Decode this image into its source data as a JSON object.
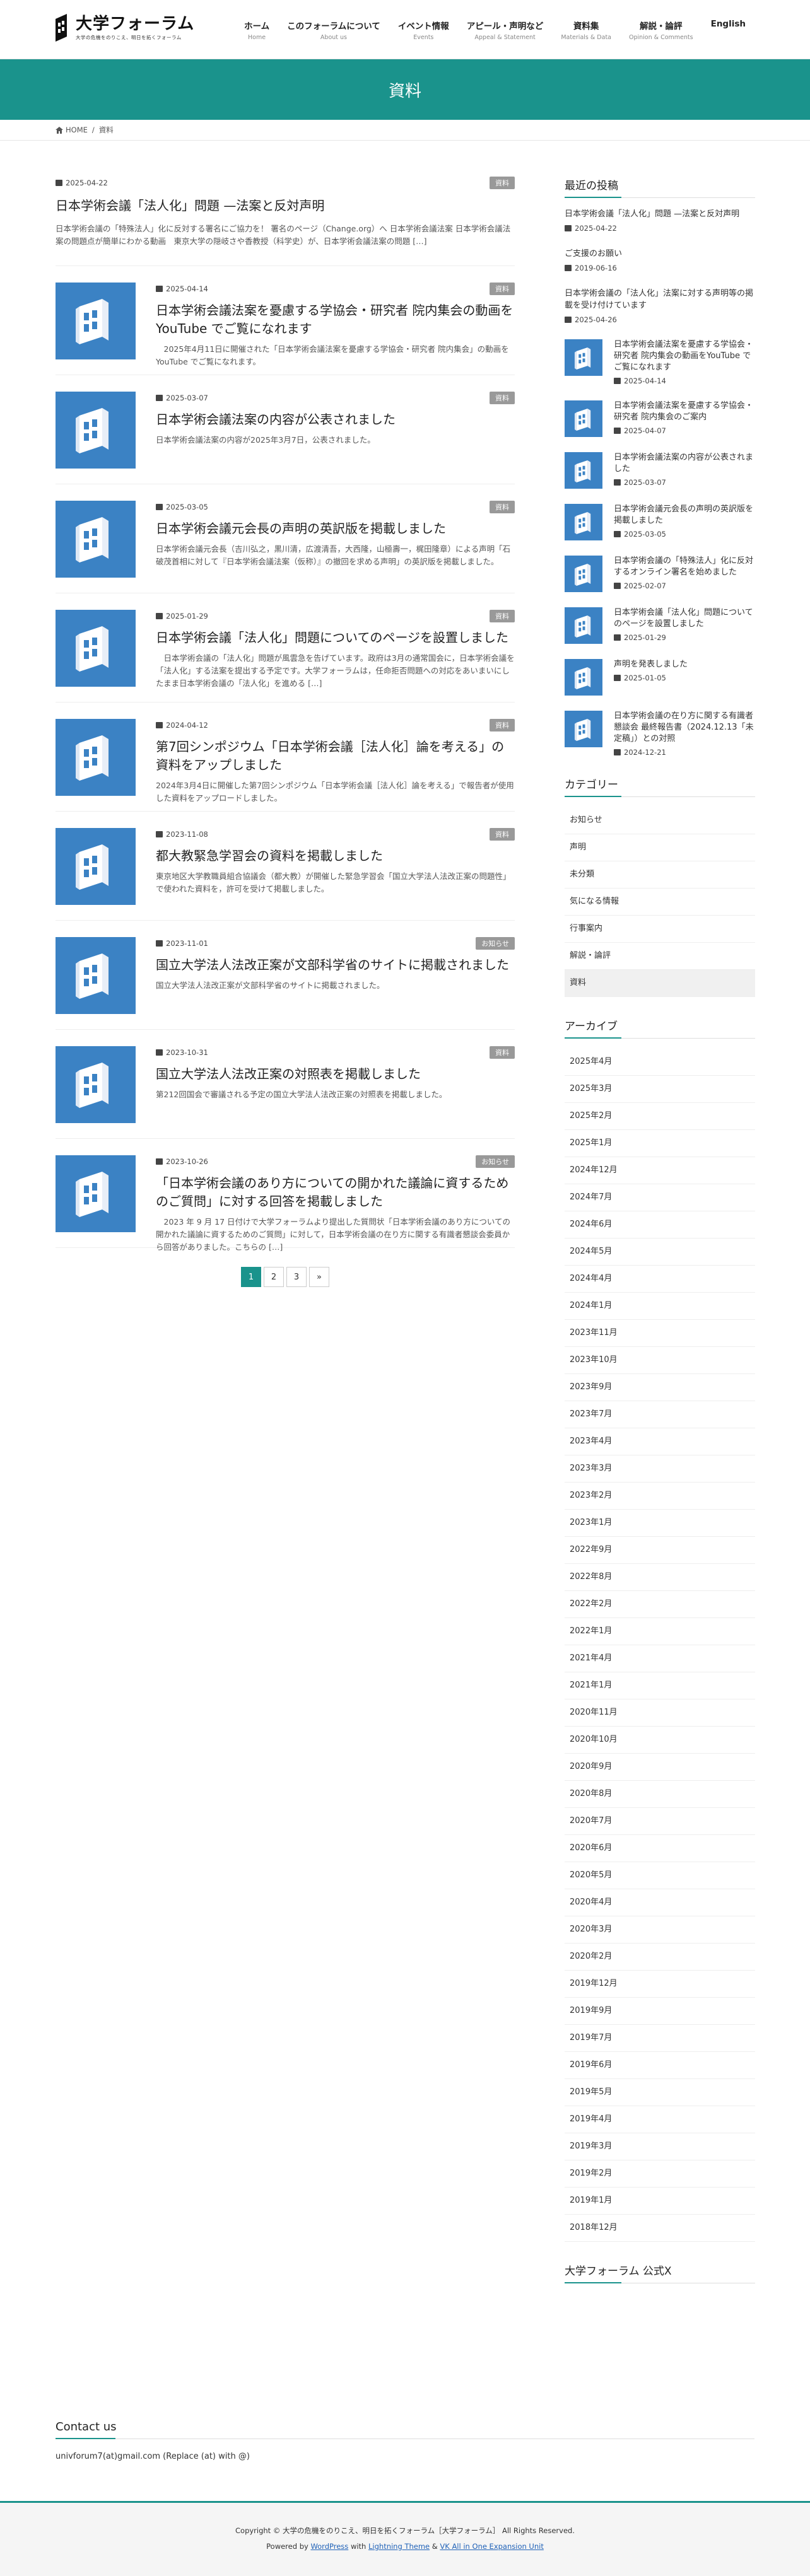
{
  "site": {
    "logo_main": "大学フォーラム",
    "logo_sub": "大学の危機をのりこえ、明日を拓くフォーラム"
  },
  "nav": [
    {
      "ja": "ホーム",
      "en": "Home"
    },
    {
      "ja": "このフォーラムについて",
      "en": "About us"
    },
    {
      "ja": "イベント情報",
      "en": "Events"
    },
    {
      "ja": "アピール・声明など",
      "en": "Appeal & Statement"
    },
    {
      "ja": "資料集",
      "en": "Materials & Data"
    },
    {
      "ja": "解説・論評",
      "en": "Opinion & Comments"
    },
    {
      "ja": "English",
      "en": ""
    }
  ],
  "page_title": "資料",
  "breadcrumb": {
    "home": "HOME",
    "sep": "/",
    "current": "資料"
  },
  "first_post": {
    "date": "2025-04-22",
    "badge": "資料",
    "title": "日本学術会議「法人化」問題 —法案と反対声明",
    "excerpt": "日本学術会議の「特殊法人」化に反対する署名にご協力を！ 署名のページ（Change.org）へ 日本学術会議法案 日本学術会議法案の問題点が簡単にわかる動画　東京大学の隠岐さや香教授（科学史）が、日本学術会議法案の問題 […]"
  },
  "posts": [
    {
      "date": "2025-04-14",
      "badge": "資料",
      "title": "日本学術会議法案を憂慮する学協会・研究者 院内集会の動画をYouTube でご覧になれます",
      "excerpt": "　2025年4月11日に開催された「日本学術会議法案を憂慮する学協会・研究者 院内集会」の動画を YouTube でご覧になれます。"
    },
    {
      "date": "2025-03-07",
      "badge": "資料",
      "title": "日本学術会議法案の内容が公表されました",
      "excerpt": "日本学術会議法案の内容が2025年3月7日，公表されました。"
    },
    {
      "date": "2025-03-05",
      "badge": "資料",
      "title": "日本学術会議元会長の声明の英訳版を掲載しました",
      "excerpt": "日本学術会議元会長（吉川弘之，黒川清，広渡清吾，大西隆，山極壽一，梶田隆章）による声明「石破茂首相に対して『日本学術会議法案（仮称）』の撤回を求める声明」の英訳版を掲載しました。"
    },
    {
      "date": "2025-01-29",
      "badge": "資料",
      "title": "日本学術会議「法人化」問題についてのページを設置しました",
      "excerpt": "　日本学術会議の「法人化」問題が風雲急を告げています。政府は3月の通常国会に，日本学術会議を「法人化」する法案を提出する予定です。大学フォーラムは，任命拒否問題への対応をあいまいにしたまま日本学術会議の「法人化」を進める […]"
    },
    {
      "date": "2024-04-12",
      "badge": "資料",
      "title": "第7回シンポジウム「日本学術会議［法人化］論を考える」の資料をアップしました",
      "excerpt": "2024年3月4日に開催した第7回シンポジウム「日本学術会議［法人化］論を考える」で報告者が使用した資料をアップロードしました。"
    },
    {
      "date": "2023-11-08",
      "badge": "資料",
      "title": "都大教緊急学習会の資料を掲載しました",
      "excerpt": "東京地区大学教職員組合協議会（都大教）が開催した緊急学習会「国立大学法人法改正案の問題性」で使われた資料を，許可を受けて掲載しました。"
    },
    {
      "date": "2023-11-01",
      "badge": "お知らせ",
      "title": "国立大学法人法改正案が文部科学省のサイトに掲載されました",
      "excerpt": "国立大学法人法改正案が文部科学省のサイトに掲載されました。"
    },
    {
      "date": "2023-10-31",
      "badge": "資料",
      "title": "国立大学法人法改正案の対照表を掲載しました",
      "excerpt": "第212回国会で審議される予定の国立大学法人法改正案の対照表を掲載しました。"
    },
    {
      "date": "2023-10-26",
      "badge": "お知らせ",
      "title": "「日本学術会議のあり方についての開かれた議論に資するためのご質問」に対する回答を掲載しました",
      "excerpt": "　2023 年 9 月 17 日付けで大学フォーラムより提出した質問状「日本学術会議のあり方についての開かれた議論に資するためのご質問」に対して，日本学術会議の在り方に関する有識者懇談会委員から回答がありました。こちらの […]"
    }
  ],
  "pagination": [
    "1",
    "2",
    "3",
    "»"
  ],
  "sidebar": {
    "recent_title": "最近の投稿",
    "recent_text": [
      {
        "title": "日本学術会議「法人化」問題 —法案と反対声明",
        "date": "2025-04-22"
      },
      {
        "title": "ご支援のお願い",
        "date": "2019-06-16"
      },
      {
        "title": "日本学術会議の「法人化」法案に対する声明等の掲載を受け付けています",
        "date": "2025-04-26"
      }
    ],
    "recent_thumb": [
      {
        "title": "日本学術会議法案を憂慮する学協会・研究者 院内集会の動画をYouTube でご覧になれます",
        "date": "2025-04-14"
      },
      {
        "title": "日本学術会議法案を憂慮する学協会・研究者 院内集会のご案内",
        "date": "2025-04-07"
      },
      {
        "title": "日本学術会議法案の内容が公表されました",
        "date": "2025-03-07"
      },
      {
        "title": "日本学術会議元会長の声明の英訳版を掲載しました",
        "date": "2025-03-05"
      },
      {
        "title": "日本学術会議の「特殊法人」化に反対するオンライン署名を始めました",
        "date": "2025-02-07"
      },
      {
        "title": "日本学術会議「法人化」問題についてのページを設置しました",
        "date": "2025-01-29"
      },
      {
        "title": "声明を発表しました",
        "date": "2025-01-05"
      },
      {
        "title": "日本学術会議の在り方に関する有識者懇談会 最終報告書（2024.12.13「未定稿」）との対照",
        "date": "2024-12-21"
      }
    ],
    "category_title": "カテゴリー",
    "categories": [
      "お知らせ",
      "声明",
      "未分類",
      "気になる情報",
      "行事案内",
      "解説・論評",
      "資料"
    ],
    "archive_title": "アーカイブ",
    "archives": [
      "2025年4月",
      "2025年3月",
      "2025年2月",
      "2025年1月",
      "2024年12月",
      "2024年7月",
      "2024年6月",
      "2024年5月",
      "2024年4月",
      "2024年1月",
      "2023年11月",
      "2023年10月",
      "2023年9月",
      "2023年7月",
      "2023年4月",
      "2023年3月",
      "2023年2月",
      "2023年1月",
      "2022年9月",
      "2022年8月",
      "2022年2月",
      "2022年1月",
      "2021年4月",
      "2021年1月",
      "2020年11月",
      "2020年10月",
      "2020年9月",
      "2020年8月",
      "2020年7月",
      "2020年6月",
      "2020年5月",
      "2020年4月",
      "2020年3月",
      "2020年2月",
      "2019年12月",
      "2019年9月",
      "2019年7月",
      "2019年6月",
      "2019年5月",
      "2019年4月",
      "2019年3月",
      "2019年2月",
      "2019年1月",
      "2018年12月"
    ],
    "x_title": "大学フォーラム 公式X"
  },
  "contact": {
    "title": "Contact us",
    "email": "univforum7(at)gmail.com (Replace (at) with @)"
  },
  "footer": {
    "copyright": "Copyright © 大学の危機をのりこえ、明日を拓くフォーラム［大学フォーラム］ All Rights Reserved.",
    "powered_prefix": "Powered by",
    "wordpress": "WordPress",
    "with": "with",
    "theme": "Lightning Theme",
    "amp": "&",
    "plugin": "VK All in One Expansion Unit"
  },
  "colors": {
    "accent": "#1a938c",
    "thumb_blue": "#3b82c4",
    "badge_gray": "#999999"
  }
}
